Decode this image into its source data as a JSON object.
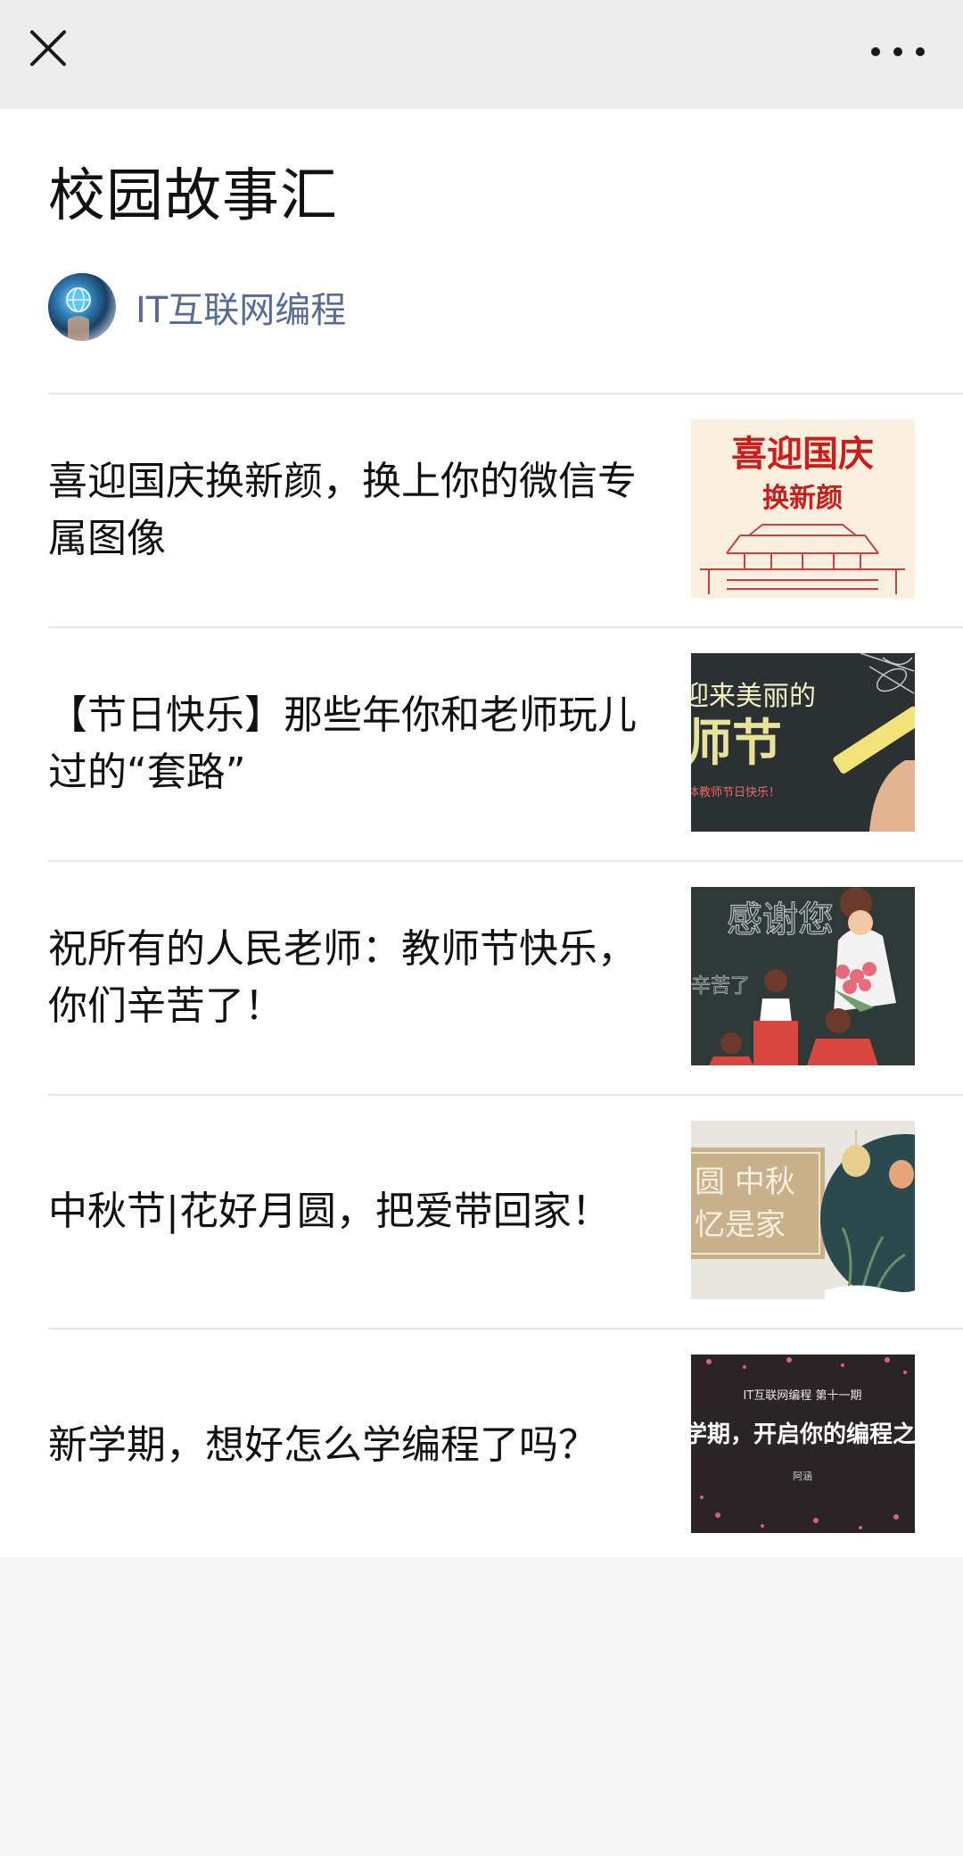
{
  "topbar": {
    "close_icon": "close-icon",
    "more_icon": "more-dots-icon"
  },
  "header": {
    "title": "校园故事汇",
    "author_name": "IT互联网编程"
  },
  "articles": [
    {
      "title": "喜迎国庆换新颜，换上你的微信专属图像",
      "thumb_text": [
        "喜迎国庆",
        "换新颜"
      ]
    },
    {
      "title": "【节日快乐】那些年你和老师玩儿过的“套路”",
      "thumb_text": [
        "迎来美丽的",
        "师节",
        "体教师节日快乐！"
      ]
    },
    {
      "title": "祝所有的人民老师：教师节快乐，你们辛苦了！",
      "thumb_text": [
        "感谢您",
        "辛苦了"
      ]
    },
    {
      "title": "中秋节|花好月圆，把爱带回家！",
      "thumb_text": [
        "圆 中秋",
        "忆是家"
      ]
    },
    {
      "title": "新学期，想好怎么学编程了吗？",
      "thumb_text": [
        "IT互联网编程  第十一期",
        "学期，开启你的编程之",
        "阿涵"
      ]
    }
  ],
  "colors": {
    "topbar_bg": "#ededed",
    "page_bg": "#f7f7f7",
    "link": "#576b95",
    "divider": "#e6e6e6"
  }
}
